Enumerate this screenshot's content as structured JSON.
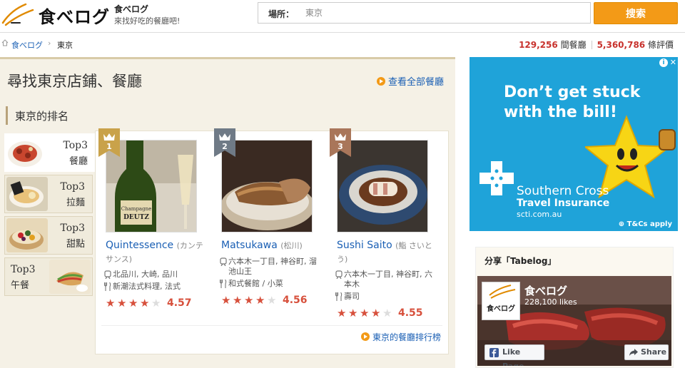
{
  "header": {
    "logo_text": "食べログ",
    "site_name": "食べログ",
    "tagline": "來找好吃的餐廳吧!",
    "search_label": "場所：",
    "search_placeholder": "東京",
    "search_button": "搜索"
  },
  "breadcrumb": {
    "items": [
      "食べログ",
      "東京"
    ]
  },
  "stats": {
    "restaurants_count": "129,256",
    "restaurants_label": "間餐廳",
    "reviews_count": "5,360,786",
    "reviews_label": "條評價"
  },
  "main": {
    "title": "尋找東京店鋪、餐廳",
    "view_all_link": "查看全部餐廳",
    "section_title": "東京的排名",
    "tabs": [
      {
        "line1": "Top3",
        "line2": "餐廳",
        "active": true
      },
      {
        "line1": "Top3",
        "line2": "拉麵",
        "active": false
      },
      {
        "line1": "Top3",
        "line2": "甜點",
        "active": false
      },
      {
        "line1": "Top3",
        "line2": "午餐",
        "active": false
      }
    ],
    "ranking": [
      {
        "rank": "1",
        "name": "Quintessence",
        "kana": "(カンテサンス)",
        "location": "北品川, 大崎, 品川",
        "category": "新潮法式料理, 法式",
        "rating": 4.57,
        "score": "4.57",
        "rank_color": "#c9a24a"
      },
      {
        "rank": "2",
        "name": "Matsukawa",
        "kana": "(松川)",
        "location": "六本木一丁目, 神谷町, 溜池山王",
        "category": "和式餐館 / 小菜",
        "rating": 4.56,
        "score": "4.56",
        "rank_color": "#6f7a86"
      },
      {
        "rank": "3",
        "name": "Sushi Saito",
        "kana": "(鮨 さいとう)",
        "location": "六本木一丁目, 神谷町, 六本木",
        "category": "壽司",
        "rating": 4.55,
        "score": "4.55",
        "rank_color": "#a9765a"
      }
    ],
    "ranking_link": "東京的餐廳排行榜"
  },
  "ad": {
    "headline_1": "Don’t get stuck",
    "headline_2": "with the bill!",
    "brand_1": "Southern Cross",
    "brand_2": "Travel Insurance",
    "url": "scti.com.au",
    "terms": "T&Cs apply",
    "bg_color": "#1fa3d9"
  },
  "share": {
    "title": "分享「Tabelog」",
    "page_name": "食べログ",
    "likes": "228,100 likes",
    "like_button": "Like Page",
    "share_button": "Share",
    "logo_text": "食べログ"
  },
  "colors": {
    "accent": "#f39a17",
    "link": "#1a5fb4",
    "rating": "#d7503c"
  }
}
